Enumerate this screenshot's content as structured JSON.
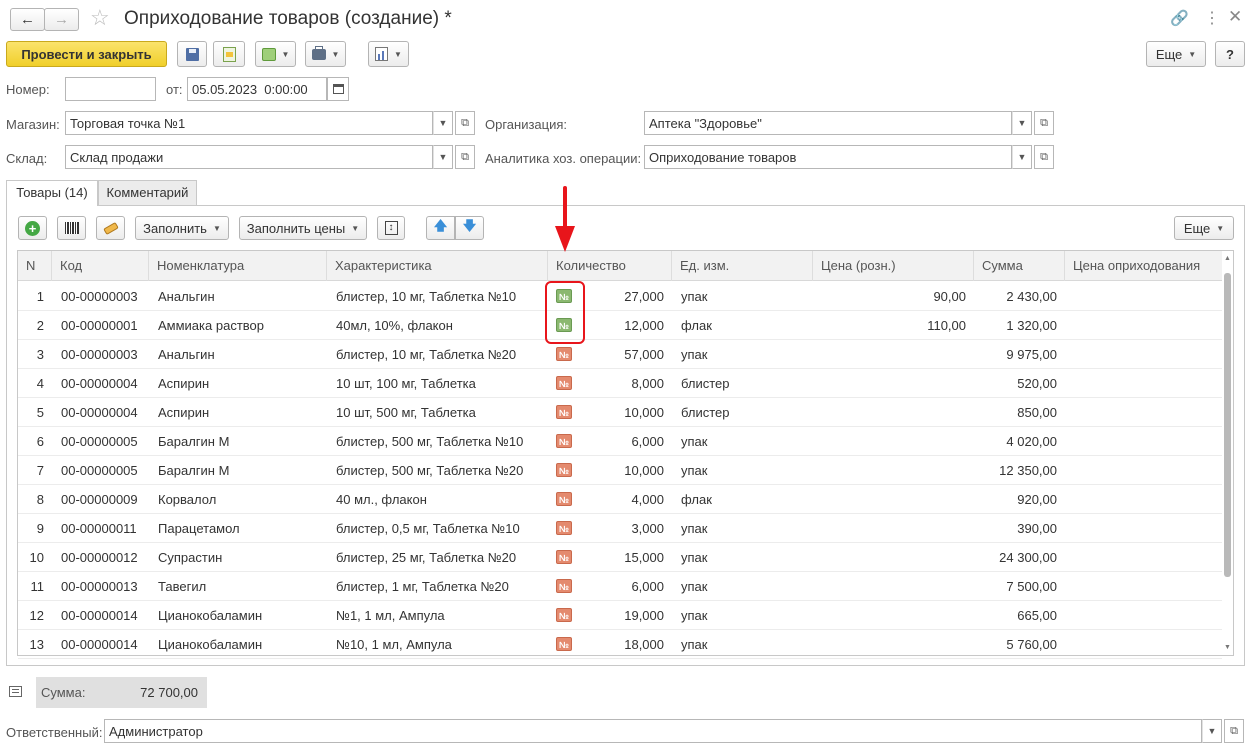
{
  "header": {
    "title": "Оприходование товаров (создание) *"
  },
  "toolbar": {
    "post_close": "Провести и закрыть",
    "more": "Еще",
    "help": "?"
  },
  "form": {
    "number_label": "Номер:",
    "number_value": "",
    "date_label": "от:",
    "date_value": "05.05.2023  0:00:00",
    "store_label": "Магазин:",
    "store_value": "Торговая точка №1",
    "org_label": "Организация:",
    "org_value": "Аптека \"Здоровье\"",
    "warehouse_label": "Склад:",
    "warehouse_value": "Склад продажи",
    "analytics_label": "Аналитика хоз. операции:",
    "analytics_value": "Оприходование товаров"
  },
  "tabs": [
    {
      "label": "Товары (14)"
    },
    {
      "label": "Комментарий"
    }
  ],
  "table_toolbar": {
    "fill": "Заполнить",
    "fill_prices": "Заполнить цены",
    "more": "Еще"
  },
  "table": {
    "columns": [
      "N",
      "Код",
      "Номенклатура",
      "Характеристика",
      "Количество",
      "Ед. изм.",
      "Цена (розн.)",
      "Сумма",
      "Цена оприходования"
    ],
    "icon_glyph": "№",
    "rows": [
      {
        "n": "1",
        "code": "00-00000003",
        "name": "Анальгин",
        "char": "блистер, 10 мг, Таблетка №10",
        "icon": "green",
        "qty": "27,000",
        "unit": "упак",
        "price": "90,00",
        "sum": "2 430,00",
        "cost": ""
      },
      {
        "n": "2",
        "code": "00-00000001",
        "name": "Аммиака раствор",
        "char": "40мл, 10%, флакон",
        "icon": "green",
        "qty": "12,000",
        "unit": "флак",
        "price": "110,00",
        "sum": "1 320,00",
        "cost": ""
      },
      {
        "n": "3",
        "code": "00-00000003",
        "name": "Анальгин",
        "char": "блистер, 10 мг, Таблетка №20",
        "icon": "orange",
        "qty": "57,000",
        "unit": "упак",
        "price": "",
        "sum": "9 975,00",
        "cost": ""
      },
      {
        "n": "4",
        "code": "00-00000004",
        "name": "Аспирин",
        "char": "10 шт, 100 мг, Таблетка",
        "icon": "orange",
        "qty": "8,000",
        "unit": "блистер",
        "price": "",
        "sum": "520,00",
        "cost": ""
      },
      {
        "n": "5",
        "code": "00-00000004",
        "name": "Аспирин",
        "char": "10 шт, 500 мг, Таблетка",
        "icon": "orange",
        "qty": "10,000",
        "unit": "блистер",
        "price": "",
        "sum": "850,00",
        "cost": ""
      },
      {
        "n": "6",
        "code": "00-00000005",
        "name": "Баралгин М",
        "char": "блистер, 500 мг, Таблетка №10",
        "icon": "orange",
        "qty": "6,000",
        "unit": "упак",
        "price": "",
        "sum": "4 020,00",
        "cost": ""
      },
      {
        "n": "7",
        "code": "00-00000005",
        "name": "Баралгин М",
        "char": "блистер, 500 мг, Таблетка №20",
        "icon": "orange",
        "qty": "10,000",
        "unit": "упак",
        "price": "",
        "sum": "12 350,00",
        "cost": ""
      },
      {
        "n": "8",
        "code": "00-00000009",
        "name": "Корвалол",
        "char": "40 мл., флакон",
        "icon": "orange",
        "qty": "4,000",
        "unit": "флак",
        "price": "",
        "sum": "920,00",
        "cost": ""
      },
      {
        "n": "9",
        "code": "00-00000011",
        "name": "Парацетамол",
        "char": "блистер, 0,5 мг, Таблетка №10",
        "icon": "orange",
        "qty": "3,000",
        "unit": "упак",
        "price": "",
        "sum": "390,00",
        "cost": ""
      },
      {
        "n": "10",
        "code": "00-00000012",
        "name": "Супрастин",
        "char": "блистер, 25 мг, Таблетка №20",
        "icon": "orange",
        "qty": "15,000",
        "unit": "упак",
        "price": "",
        "sum": "24 300,00",
        "cost": ""
      },
      {
        "n": "11",
        "code": "00-00000013",
        "name": "Тавегил",
        "char": "блистер, 1 мг, Таблетка №20",
        "icon": "orange",
        "qty": "6,000",
        "unit": "упак",
        "price": "",
        "sum": "7 500,00",
        "cost": ""
      },
      {
        "n": "12",
        "code": "00-00000014",
        "name": "Цианокобаламин",
        "char": "№1, 1 мл, Ампула",
        "icon": "orange",
        "qty": "19,000",
        "unit": "упак",
        "price": "",
        "sum": "665,00",
        "cost": ""
      },
      {
        "n": "13",
        "code": "00-00000014",
        "name": "Цианокобаламин",
        "char": "№10, 1 мл, Ампула",
        "icon": "orange",
        "qty": "18,000",
        "unit": "упак",
        "price": "",
        "sum": "5 760,00",
        "cost": ""
      }
    ]
  },
  "footer": {
    "sum_label": "Сумма:",
    "sum_value": "72 700,00",
    "responsible_label": "Ответственный:",
    "responsible_value": "Администратор"
  },
  "colors": {
    "primary_button": "#f5d63c",
    "annotation": "#e8151b",
    "icon_green": "#8bb870",
    "icon_orange": "#e48a6e"
  }
}
